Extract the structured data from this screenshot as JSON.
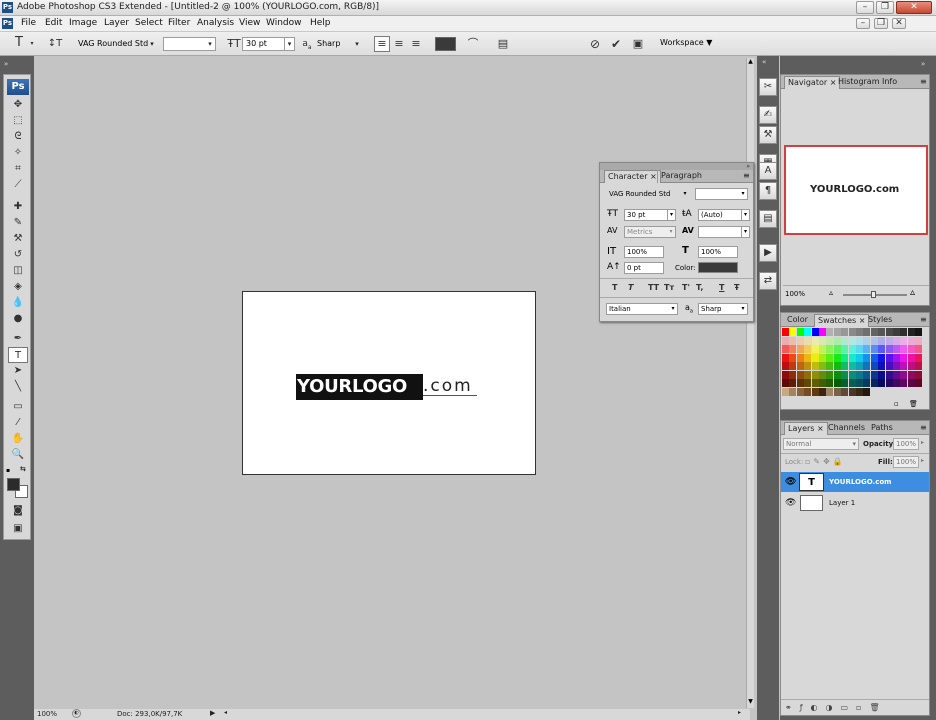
{
  "window": {
    "title": "Adobe Photoshop CS3 Extended - [Untitled-2 @ 100% (YOURLOGO.com, RGB/8)]",
    "app_icon": "Ps"
  },
  "menu": [
    "File",
    "Edit",
    "Image",
    "Layer",
    "Select",
    "Filter",
    "Analysis",
    "View",
    "Window",
    "Help"
  ],
  "options": {
    "font_family": "VAG Rounded Std",
    "font_style": "",
    "font_size": "30 pt",
    "aa_label": "a",
    "aa_sub": "a",
    "antialias": "Sharp",
    "workspace": "Workspace ▼",
    "color": "#3a3a3a"
  },
  "toolbox": {
    "logo": "Ps",
    "foreground": "#2b2b2b",
    "background": "#ffffff"
  },
  "canvas": {
    "logo_selected": "YOURLOGO",
    "logo_rest": ".com"
  },
  "status": {
    "zoom": "100%",
    "doc": "Doc: 293,0K/97,7K"
  },
  "navigator": {
    "tabs": [
      "Navigator",
      "Histogram",
      "Info"
    ],
    "preview_text": "YOURLOGO.com",
    "zoom": "100%"
  },
  "swatches": {
    "tabs": [
      "Color",
      "Swatches",
      "Styles"
    ]
  },
  "layers": {
    "tabs": [
      "Layers",
      "Channels",
      "Paths"
    ],
    "blend_mode": "Normal",
    "opacity_label": "Opacity:",
    "opacity": "100%",
    "lock_label": "Lock:",
    "fill_label": "Fill:",
    "fill": "100%",
    "items": [
      {
        "name": "YOURLOGO.com",
        "thumb": "T",
        "selected": true
      },
      {
        "name": "Layer 1",
        "thumb": "",
        "selected": false
      }
    ]
  },
  "character": {
    "tabs": [
      "Character",
      "Paragraph"
    ],
    "font_family": "VAG Rounded Std",
    "font_style": "",
    "size": "30 pt",
    "leading": "(Auto)",
    "kerning": "Metrics",
    "tracking": "",
    "vscale": "100%",
    "hscale": "100%",
    "baseline": "0 pt",
    "color_label": "Color:",
    "color": "#3a3a3a",
    "style_buttons": [
      "T",
      "T",
      "TT",
      "Tт",
      "T'",
      "T,",
      "T",
      "Ŧ"
    ],
    "language": "Italian",
    "aa_label": "a",
    "aa_sub": "a",
    "antialias": "Sharp"
  }
}
